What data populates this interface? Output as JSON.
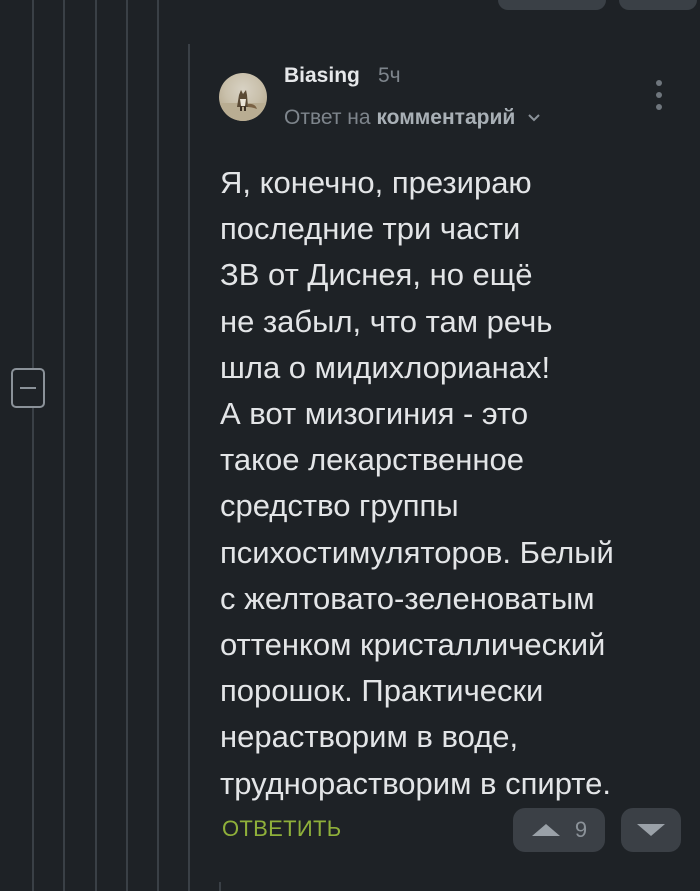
{
  "comment": {
    "username": "Biasing",
    "time": "5ч",
    "reply_prefix": "Ответ на",
    "reply_target": "комментарий",
    "body_lines": [
      "Я, конечно, презираю",
      "последние три части",
      "ЗВ от Диснея, но ещё",
      "не забыл, что там речь",
      "шла о мидихлорианах!",
      "А вот мизогиния - это",
      "такое лекарственное",
      "средство группы",
      "психостимуляторов. Белый",
      "с желтовато-зеленоватым",
      "оттенком кристаллический",
      "порошок. Практически",
      "нерастворим в воде,",
      "труднорастворим в спирте."
    ]
  },
  "actions": {
    "reply_label": "ОТВЕТИТЬ",
    "rating": "9"
  },
  "icons": {
    "collapse": "minus-square-icon",
    "menu": "kebab-menu-icon",
    "upvote": "triangle-up-icon",
    "downvote": "triangle-down-icon",
    "expand": "chevron-down-icon"
  },
  "colors": {
    "background": "#1e2226",
    "accent": "#8fb03a",
    "text": "#e3e5e7",
    "muted": "#7e858c"
  }
}
